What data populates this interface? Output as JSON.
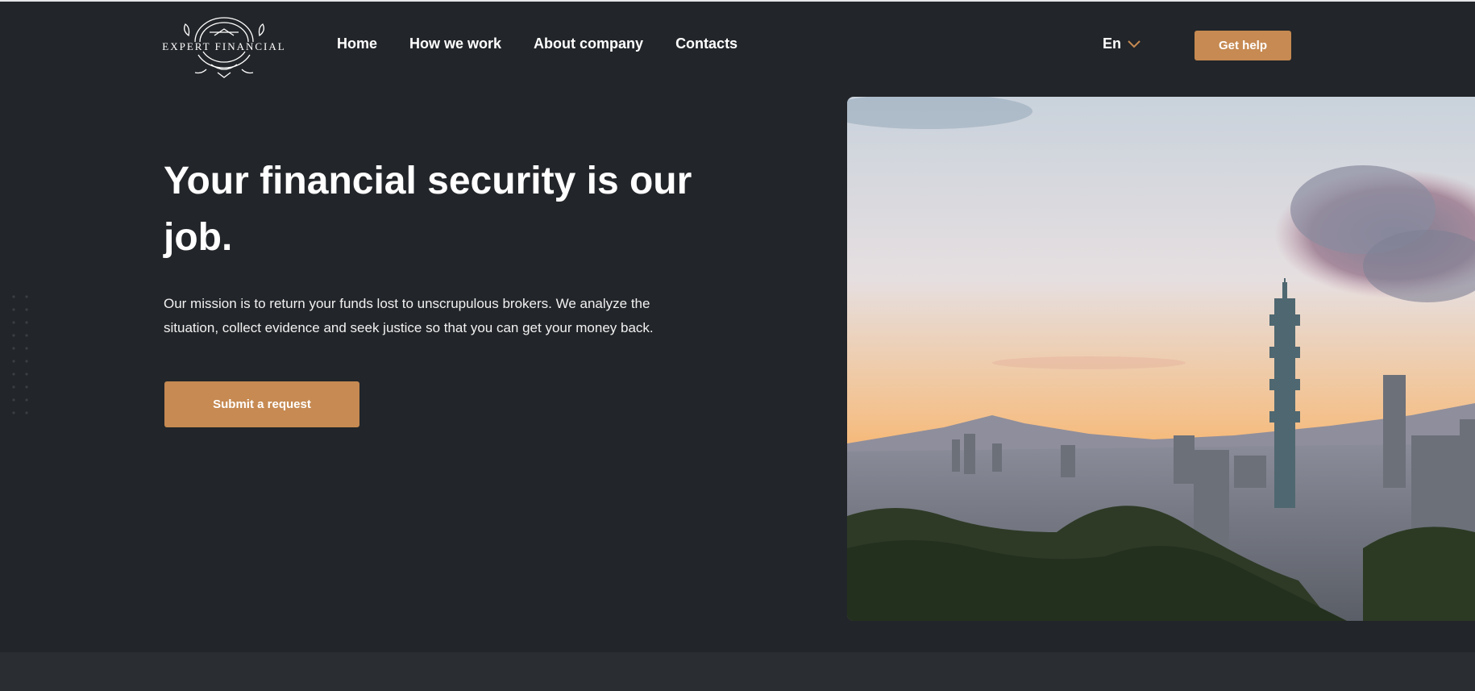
{
  "header": {
    "logo_text": "EXPERT FINANCIAL",
    "nav": [
      {
        "label": "Home"
      },
      {
        "label": "How we work"
      },
      {
        "label": "About company"
      },
      {
        "label": "Contacts"
      }
    ],
    "language": "En",
    "help_button": "Get help"
  },
  "hero": {
    "title": "Your financial security is our job.",
    "text": "Our mission is to return your funds lost to unscrupulous brokers. We analyze the situation, collect evidence and seek justice so that you can get your money back.",
    "submit_button": "Submit a request"
  },
  "colors": {
    "background": "#222529",
    "accent": "#c68a52",
    "bottom_band": "#2a2d31"
  },
  "icons": {
    "language_toggle": "chevron-down-icon",
    "logo": "crest-logo-icon"
  }
}
